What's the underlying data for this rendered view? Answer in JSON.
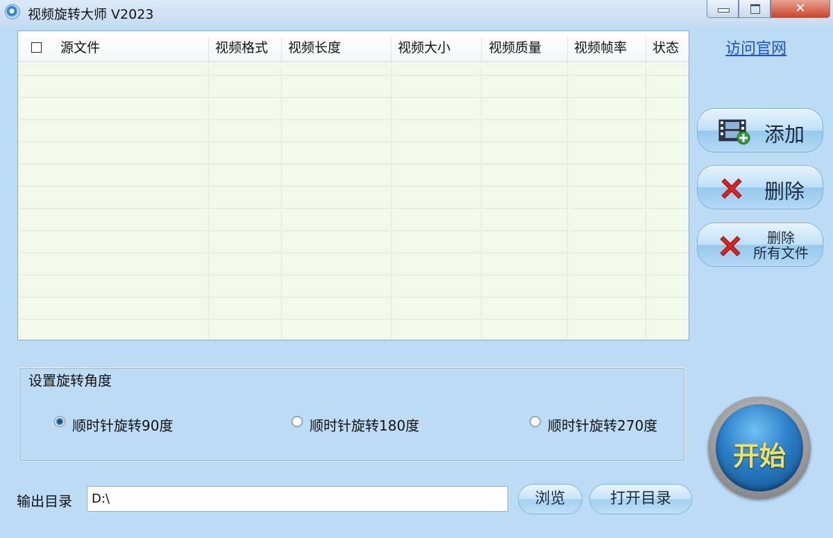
{
  "window": {
    "title": "视频旋转大师 V2023",
    "close_glyph": "✕"
  },
  "table": {
    "columns": [
      "源文件",
      "视频格式",
      "视频长度",
      "视频大小",
      "视频质量",
      "视频帧率",
      "状态"
    ],
    "rows": []
  },
  "sidebar": {
    "official_link": "访问官网",
    "add_label": "添加",
    "delete_label": "删除",
    "delete_all_line1": "删除",
    "delete_all_line2": "所有文件"
  },
  "rotation": {
    "legend": "设置旋转角度",
    "options": [
      "顺时针旋转90度",
      "顺时针旋转180度",
      "顺时针旋转270度"
    ],
    "selected_index": 0
  },
  "output": {
    "label": "输出目录",
    "value": "D:\\",
    "browse_label": "浏览",
    "open_dir_label": "打开目录"
  },
  "start": {
    "label": "开始"
  },
  "icons": {
    "app": "app-logo-icon",
    "add": "film-add-icon",
    "delete": "red-x-icon",
    "delete_all": "red-x-icon"
  },
  "colors": {
    "window_bg": "#bcdcf6",
    "table_bg": "#f3f9ea",
    "link": "#1a4fd8",
    "start_text": "#f2e25a",
    "delete_red": "#d8231f"
  }
}
